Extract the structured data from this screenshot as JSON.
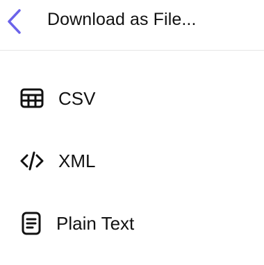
{
  "header": {
    "title": "Download as File...",
    "back_icon": "chevron-left-icon",
    "accent_color": "#6b63ea"
  },
  "menu": {
    "items": [
      {
        "label": "CSV",
        "icon": "table-icon"
      },
      {
        "label": "XML",
        "icon": "code-icon"
      },
      {
        "label": "Plain Text",
        "icon": "document-text-icon"
      }
    ]
  }
}
